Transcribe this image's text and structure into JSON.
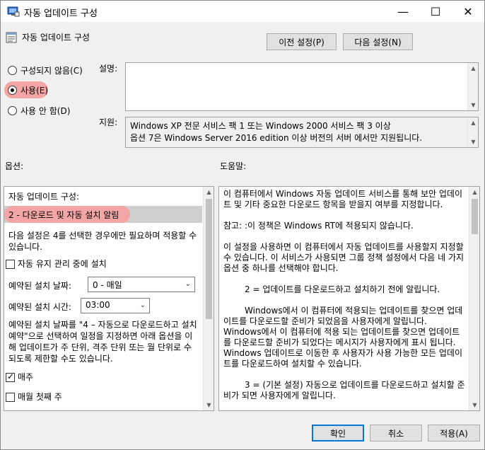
{
  "window": {
    "title": "자동 업데이트 구성",
    "minimize": "—",
    "maximize": "☐",
    "close": "✕"
  },
  "header": {
    "policy_title": "자동 업데이트 구성",
    "prev_button": "이전 설정(P)",
    "next_button": "다음 설정(N)"
  },
  "state": {
    "not_configured": "구성되지 않음(C)",
    "enabled": "사용(E)",
    "disabled": "사용 안 함(D)"
  },
  "labels": {
    "comment": "설명:",
    "supported": "지원:",
    "options": "옵션:",
    "help": "도움말:"
  },
  "supported_text": [
    "Windows XP 전문 서비스 팩 1 또는 Windows 2000 서비스 팩 3 이상",
    "옵션 7은 Windows Server 2016 edition 이상 버전의 서버 에서만 지원됩니다."
  ],
  "options": {
    "configure_label": "자동 업데이트 구성:",
    "selected_mode": "2 - 다운로드 및 자동 설치 알림",
    "note_lines": [
      "다음 설정은 4를 선택한 경우에만 필요하며 적용할 수",
      "있습니다."
    ],
    "maintenance_checkbox": "자동 유지 관리 중에 설치",
    "install_day_label": "예약된 설치 날짜:",
    "install_day_value": "0 - 매일",
    "install_time_label": "예약된 설치 시간:",
    "install_time_value": "03:00",
    "desc_lines": [
      "예약된 설치 날짜를 \"4 – 자동으로 다운로드하고 설치",
      "예약\"으로 선택하여 일정을 지정하면 아래 옵션을 이",
      "해 업데이트가 주 단위, 격주 단위 또는 월 단위로 수",
      "되도록 제한할 수도 있습니다."
    ],
    "every_week": "매주",
    "first_week": "매월 첫째 주"
  },
  "help_paragraphs": [
    "이 컴퓨터에서 Windows 자동 업데이트 서비스를 통해 보안 업데이트 및 기타 중요한 다운로드 항목을 받을지 여부를 지정합니다.",
    "참고: :이 정책은 Windows RT에 적용되지 않습니다.",
    "이 설정을 사용하면 이 컴퓨터에서 자동 업데이트를 사용할지 지정할 수 있습니다. 이 서비스가 사용되면 그룹 정책 설정에서 다음 네 가지 옵션 중 하나를 선택해야 합니다.",
    "2 = 업데이트를 다운로드하고 설치하기 전에 알립니다.",
    "Windows에서 이 컴퓨터에 적용되는 업데이트를 찾으면 업데이트를 다운로드할 준비가 되었음을 사용자에게 알립니다. Windows에서 이 컴퓨터에 적용 되는 업데이트를 찾으면 업데이트를 다운로드할 준비가 되었다는 메시지가 사용자에게 표시 됩니다. Windows 업데이트로 이동한 후 사용자가 사용 가능한 모든 업데이트를 다운로드하여 설치할 수 있습니다.",
    "3 = (기본 설정) 자동으로 업데이트를 다운로드하고 설치할 준비가 되면 사용자에게 알립니다."
  ],
  "footer": {
    "ok": "확인",
    "cancel": "취소",
    "apply": "적용(A)"
  },
  "colors": {
    "highlight": "#f4a6a6",
    "accent": "#0078d7"
  }
}
